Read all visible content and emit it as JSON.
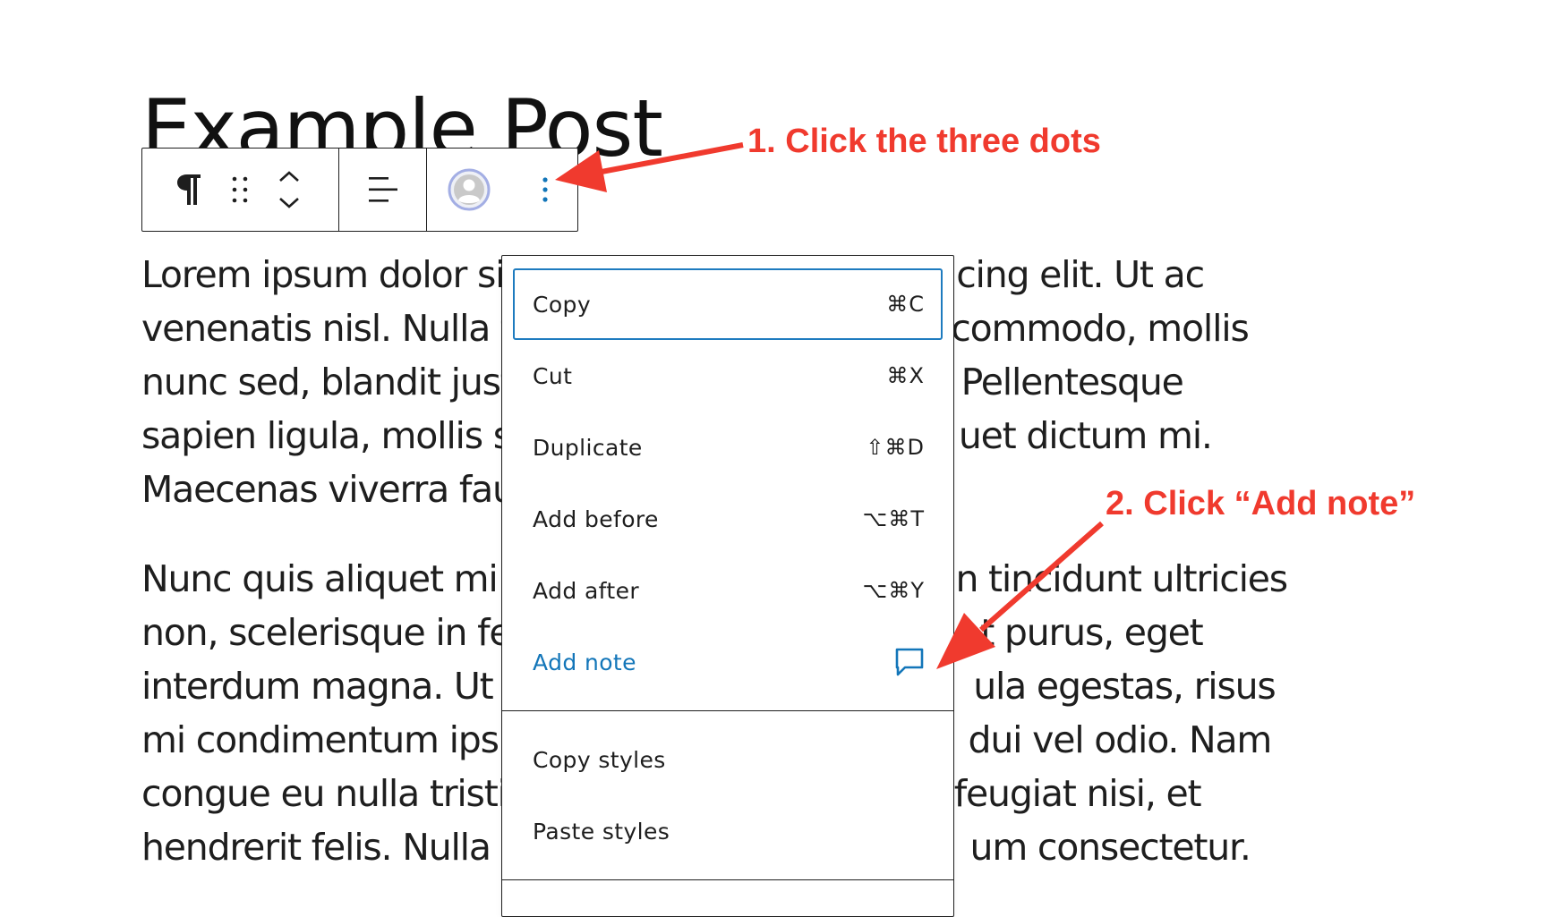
{
  "post": {
    "title": "Example Post",
    "paragraph_1": [
      "Lorem ipsum dolor sit",
      "venenatis nisl. Nulla f",
      "nunc sed, blandit just",
      "sapien ligula, mollis s",
      "Maecenas viverra fau"
    ],
    "paragraph_1_right": [
      "cing elit. Ut ac",
      "commodo, mollis",
      "Pellentesque",
      "uet dictum mi.",
      ""
    ],
    "paragraph_2": [
      "Nunc quis aliquet mi.",
      "non, scelerisque in fe",
      "interdum magna. Ut p",
      "mi condimentum ipsu",
      "congue eu nulla tristi",
      "hendrerit felis. Nulla a"
    ],
    "paragraph_2_right": [
      "n tincidunt ultricies",
      "nt purus, eget",
      "ula egestas, risus",
      "dui vel odio. Nam",
      "feugiat nisi, et",
      "um consectetur."
    ]
  },
  "toolbar": {
    "icons": [
      "paragraph-icon",
      "drag-handle-icon",
      "move-up-icon",
      "move-down-icon",
      "align-icon",
      "avatar-icon",
      "more-options-icon"
    ]
  },
  "menu": {
    "section_1": [
      {
        "label": "Copy",
        "shortcut": "⌘C"
      },
      {
        "label": "Cut",
        "shortcut": "⌘X"
      },
      {
        "label": "Duplicate",
        "shortcut": "⇧⌘D"
      },
      {
        "label": "Add before",
        "shortcut": "⌥⌘T"
      },
      {
        "label": "Add after",
        "shortcut": "⌥⌘Y"
      },
      {
        "label": "Add note",
        "shortcut": ""
      }
    ],
    "section_2": [
      {
        "label": "Copy styles"
      },
      {
        "label": "Paste styles"
      }
    ]
  },
  "annotations": {
    "step_1": "1. Click the three dots",
    "step_2": "2. Click “Add note”"
  },
  "colors": {
    "accent": "#1376b9",
    "focus_border": "#1e7bbf",
    "annotation": "#f03a2e"
  }
}
